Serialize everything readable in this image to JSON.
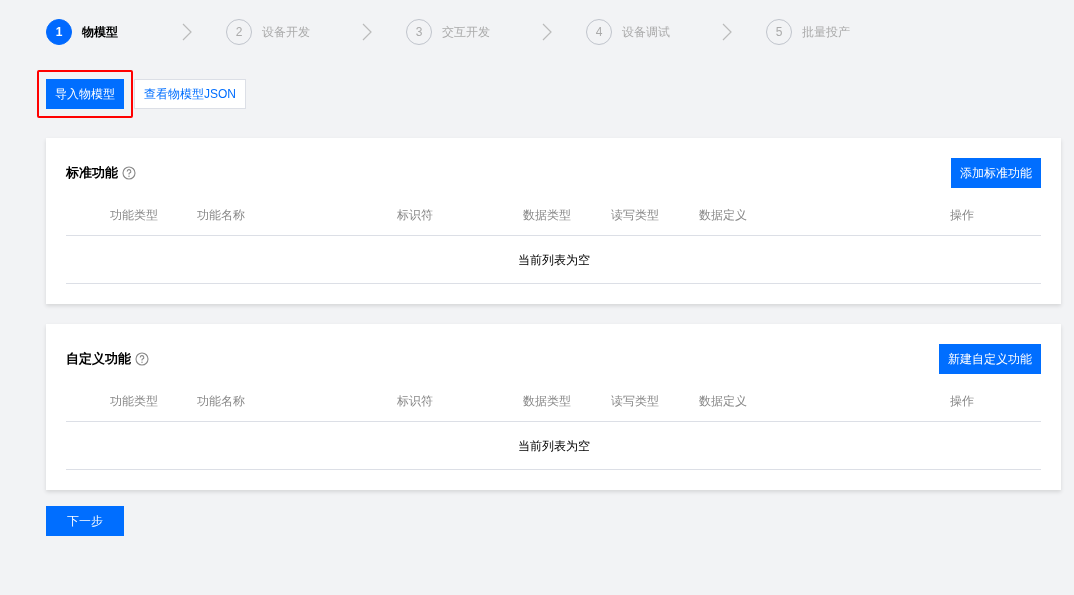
{
  "steps": [
    {
      "number": "1",
      "label": "物模型",
      "selected": true
    },
    {
      "number": "2",
      "label": "设备开发",
      "selected": false
    },
    {
      "number": "3",
      "label": "交互开发",
      "selected": false
    },
    {
      "number": "4",
      "label": "设备调试",
      "selected": false
    },
    {
      "number": "5",
      "label": "批量投产",
      "selected": false
    }
  ],
  "toolbar": [
    {
      "label": "导入物模型",
      "kind": "primary",
      "highlighted": true
    },
    {
      "label": "查看物模型JSON",
      "kind": "outline",
      "highlighted": false
    }
  ],
  "sections": [
    {
      "title": "标准功能",
      "action": "添加标准功能",
      "columns": [
        "功能类型",
        "功能名称",
        "标识符",
        "数据类型",
        "读写类型",
        "数据定义",
        "操作"
      ],
      "empty_text": "当前列表为空"
    },
    {
      "title": "自定义功能",
      "action": "新建自定义功能",
      "columns": [
        "功能类型",
        "功能名称",
        "标识符",
        "数据类型",
        "读写类型",
        "数据定义",
        "操作"
      ],
      "empty_text": "当前列表为空"
    }
  ],
  "next_button": "下一步"
}
